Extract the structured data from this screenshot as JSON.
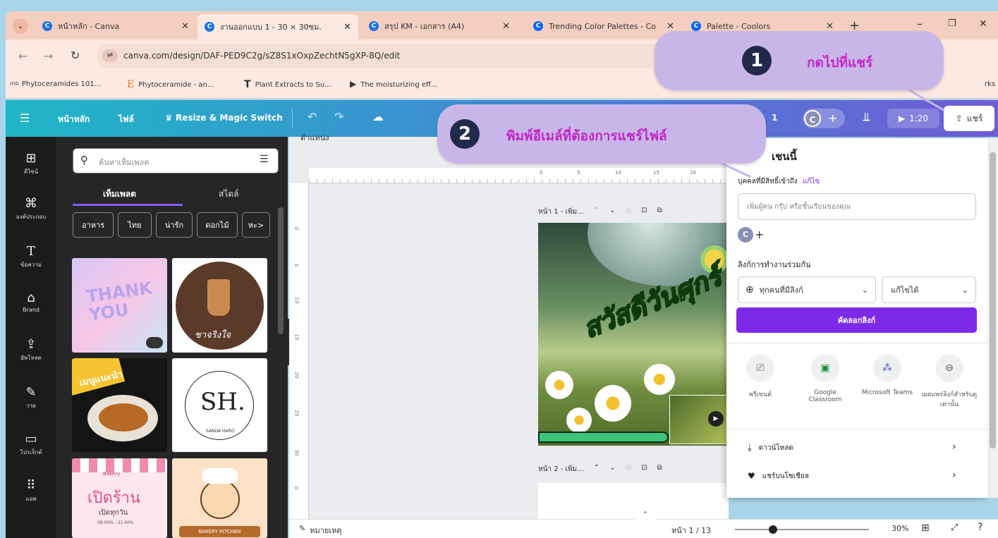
{
  "browser": {
    "tabs": [
      {
        "label": "หน้าหลัก - Canva"
      },
      {
        "label": "งานออกแบบ 1 - 30 × 30ซม."
      },
      {
        "label": "สรุป KM - เอกสาร (A4)"
      },
      {
        "label": "Trending Color Palettes - Co"
      },
      {
        "label": "Palette - Coolors"
      }
    ],
    "url": "canva.com/design/DAF-PED9C2g/sZ8S1xOxpZechtN5gXP-8Q/edit",
    "bookmarks": [
      "Phytoceramides 101...",
      "Phytoceramide - an...",
      "Plant Extracts to Su...",
      "The moisturizing eff..."
    ],
    "bookmarks_right": "rks"
  },
  "canva": {
    "home": "หน้าหลัก",
    "file": "ไฟล์",
    "resize": "Resize & Magic Switch",
    "page_count": "1",
    "avatar": "C",
    "duration": "1:20",
    "share": "แชร์"
  },
  "rail": [
    "ดีไซน์",
    "องค์ประกอบ",
    "ข้อความ",
    "Brand",
    "อัพโหลด",
    "วาด",
    "โปรเจ็กต์",
    "แอพ"
  ],
  "panel": {
    "search_placeholder": "ค้นหาเท็มเพลต",
    "tab_templates": "เท็มเพลต",
    "tab_styles": "สไตล์",
    "chips": [
      "อาหาร",
      "ไทย",
      "น่ารัก",
      "ดอกไม้",
      "หะ>"
    ],
    "thumb_texts": {
      "thankyou": "THANK YOU",
      "tea": "ชาจริงใจ",
      "menu": "เมนูแนะนำ",
      "sh": "SH.",
      "sh_sub": "SANDA HARO",
      "shop": "เปิดร้าน",
      "shop_sub": "เปิดทุกวัน",
      "shop_time": "08.00% - 21.00%",
      "shop_tag": "Bakery",
      "cafe": "BAKERY KITCHEN"
    }
  },
  "workarea": {
    "position": "ตำแหน่ง",
    "ruler": [
      "0",
      "5",
      "10",
      "15",
      "20"
    ],
    "vruler": [
      "0",
      "5",
      "10",
      "15",
      "20",
      "25",
      "30",
      "0"
    ],
    "page1_label": "หน้า 1 - เพิ่ม...",
    "page2_label": "หน้า 2 - เพิ่ม...",
    "design_text": "สวัสดีวันศุกร์"
  },
  "statusbar": {
    "notes": "หมายเหตุ",
    "page": "หน้า 1 / 13",
    "zoom": "30%"
  },
  "share_panel": {
    "title": "เชนนี้",
    "people_label": "บุคคลที่มีสิทธิ์เข้าถึง",
    "edit_link": "แก้ไข",
    "invite_placeholder": "เพิ่มผู้คน กรุ๊ป หรือชั้นเรียนของคุณ",
    "avatar": "C",
    "collab_label": "ลิงก์การทำงานร่วมกัน",
    "access_select": "ทุกคนที่มีลิงก์",
    "perm_select": "แก้ไขได้",
    "copy_button": "คัดลอกลิงก์",
    "options": [
      {
        "icon": "present-icon",
        "label": "พรีเซนต์"
      },
      {
        "icon": "classroom-icon",
        "label": "Google Classroom"
      },
      {
        "icon": "teams-icon",
        "label": "Microsoft Teams"
      },
      {
        "icon": "link-icon",
        "label": "เผยแพร่ลิงก์สำหรับดูเท่านั้น"
      }
    ],
    "download": "ดาวน์โหลด",
    "social": "แชร์บนโซเชียล"
  },
  "callouts": [
    {
      "number": "1",
      "text": "กดไปที่แชร์"
    },
    {
      "number": "2",
      "text": "พิมพ์อีเมล์ที่ต้องการแชร์ไฟล์"
    }
  ],
  "colors": {
    "callout_bg": "#c9b6e8",
    "callout_text": "#c125c9",
    "primary_purple": "#7d2ae8"
  }
}
